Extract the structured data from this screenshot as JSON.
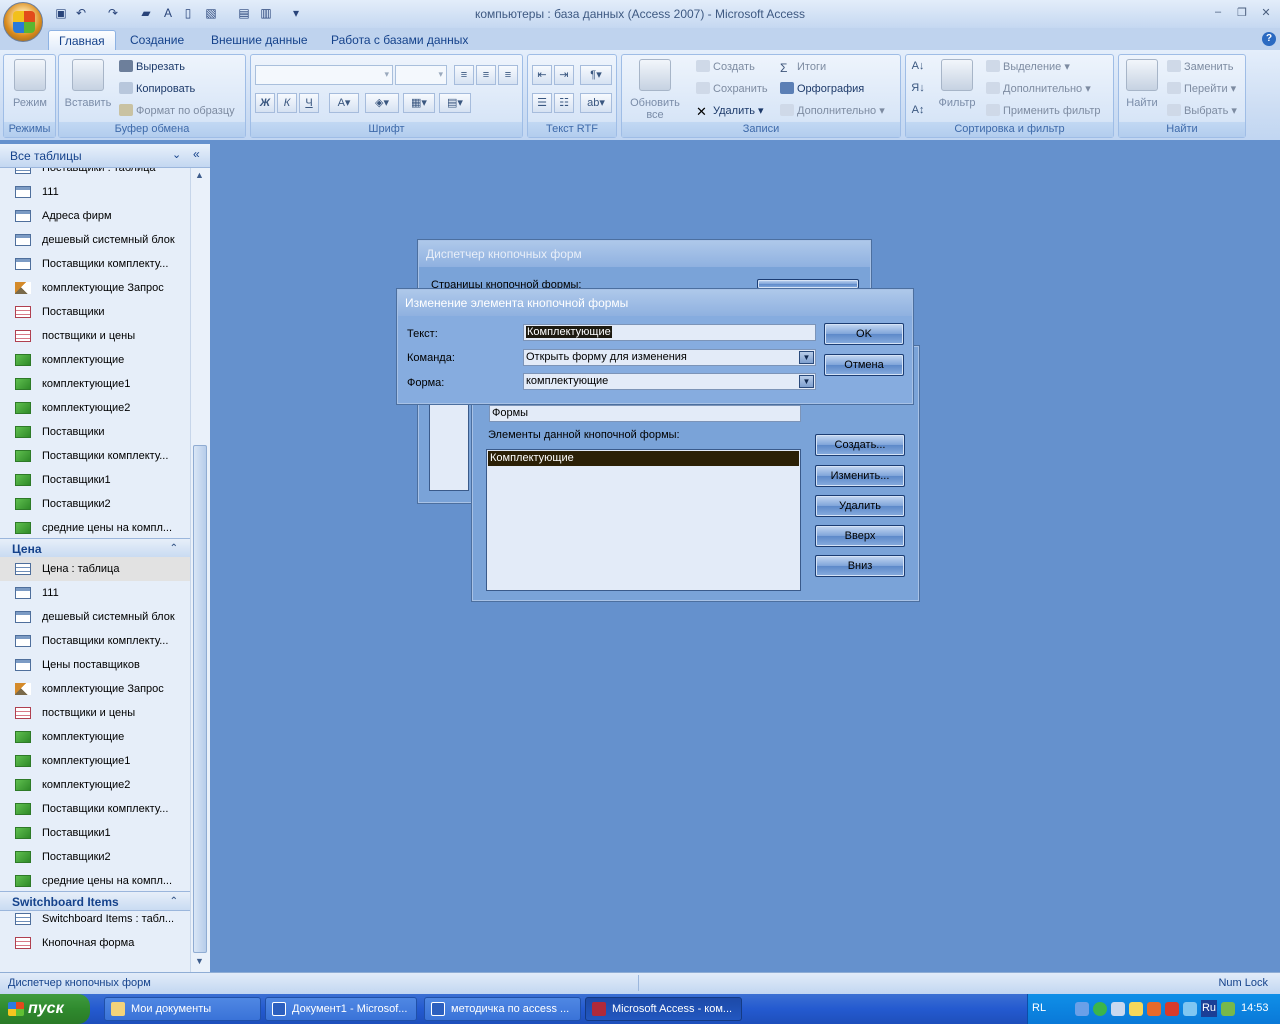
{
  "window": {
    "title": "компьютеры : база данных (Access 2007) - Microsoft Access",
    "controls": [
      "minimize",
      "restore",
      "close"
    ]
  },
  "ribbon": {
    "tabs": [
      "Главная",
      "Создание",
      "Внешние данные",
      "Работа с базами данных"
    ],
    "active_tab": "Главная",
    "groups": {
      "views": {
        "label": "Режимы",
        "mode": "Режим"
      },
      "clipboard": {
        "label": "Буфер обмена",
        "paste": "Вставить",
        "cut": "Вырезать",
        "copy": "Копировать",
        "format_painter": "Формат по образцу"
      },
      "font": {
        "label": "Шрифт",
        "bold": "Ж",
        "italic": "К",
        "underline": "Ч"
      },
      "rtf": {
        "label": "Текст RTF"
      },
      "records": {
        "label": "Записи",
        "refresh": "Обновить все",
        "new": "Создать",
        "save": "Сохранить",
        "delete": "Удалить",
        "totals": "Итоги",
        "spelling": "Орфография",
        "more": "Дополнительно"
      },
      "sort_filter": {
        "label": "Сортировка и фильтр",
        "filter": "Фильтр",
        "selection": "Выделение",
        "advanced": "Дополнительно",
        "apply_filter": "Применить фильтр"
      },
      "find": {
        "label": "Найти",
        "find": "Найти",
        "replace": "Заменить",
        "goto": "Перейти",
        "select": "Выбрать"
      }
    }
  },
  "nav": {
    "header": "Все таблицы",
    "group1_items": [
      {
        "label": "Поставщики : таблица",
        "icon": "table"
      },
      {
        "label": "111",
        "icon": "query"
      },
      {
        "label": "Адреса фирм",
        "icon": "query"
      },
      {
        "label": "дешевый системный блок",
        "icon": "query"
      },
      {
        "label": "Поставщики комплекту...",
        "icon": "query"
      },
      {
        "label": "комплектующие Запрос",
        "icon": "action"
      },
      {
        "label": "Поставщики",
        "icon": "report"
      },
      {
        "label": "поствщики и цены",
        "icon": "report"
      },
      {
        "label": "комплектующие",
        "icon": "form"
      },
      {
        "label": "комплектующие1",
        "icon": "form"
      },
      {
        "label": "комплектующие2",
        "icon": "form"
      },
      {
        "label": "Поставщики",
        "icon": "form"
      },
      {
        "label": "Поставщики комплекту...",
        "icon": "form"
      },
      {
        "label": "Поставщики1",
        "icon": "form"
      },
      {
        "label": "Поставщики2",
        "icon": "form"
      },
      {
        "label": "средние цены на компл...",
        "icon": "form"
      }
    ],
    "group2_title": "Цена",
    "group2_items": [
      {
        "label": "Цена : таблица",
        "icon": "table"
      },
      {
        "label": "111",
        "icon": "query"
      },
      {
        "label": "дешевый системный блок",
        "icon": "query"
      },
      {
        "label": "Поставщики комплекту...",
        "icon": "query"
      },
      {
        "label": "Цены поставщиков",
        "icon": "query"
      },
      {
        "label": "комплектующие Запрос",
        "icon": "action"
      },
      {
        "label": "поствщики и цены",
        "icon": "report"
      },
      {
        "label": "комплектующие",
        "icon": "form"
      },
      {
        "label": "комплектующие1",
        "icon": "form"
      },
      {
        "label": "комплектующие2",
        "icon": "form"
      },
      {
        "label": "Поставщики комплекту...",
        "icon": "form"
      },
      {
        "label": "Поставщики1",
        "icon": "form"
      },
      {
        "label": "Поставщики2",
        "icon": "form"
      },
      {
        "label": "средние цены на компл...",
        "icon": "form"
      }
    ],
    "group3_title": "Switchboard Items",
    "group3_items": [
      {
        "label": "Switchboard Items : табл...",
        "icon": "table"
      },
      {
        "label": "Кнопочная форма",
        "icon": "report"
      }
    ]
  },
  "dialog_back": {
    "title": "Диспетчер кнопочных форм",
    "pages_label": "Страницы кнопочной формы:"
  },
  "dialog_mid": {
    "name_value": "Формы",
    "items_label": "Элементы данной кнопочной формы:",
    "items": [
      "Комплектующие"
    ],
    "buttons": {
      "create": "Создать...",
      "edit": "Изменить...",
      "delete": "Удалить",
      "up": "Вверх",
      "down": "Вниз"
    }
  },
  "dialog_front": {
    "title": "Изменение элемента кнопочной формы",
    "text_label": "Текст:",
    "text_value": "Комплектующие",
    "command_label": "Команда:",
    "command_value": "Открыть форму для изменения",
    "form_label": "Форма:",
    "form_value": "комплектующие",
    "ok": "OK",
    "cancel": "Отмена"
  },
  "status": {
    "left": "Диспетчер кнопочных форм",
    "right": "Num Lock"
  },
  "taskbar": {
    "start": "пуск",
    "tasks": [
      {
        "label": "Мои документы",
        "active": false
      },
      {
        "label": "Документ1 - Microsof...",
        "active": false
      },
      {
        "label": "методичка по access ...",
        "active": false
      },
      {
        "label": "Microsoft Access - ком...",
        "active": true
      }
    ],
    "lang_left": "RL",
    "lang": "Ru",
    "clock": "14:53"
  },
  "colors": {
    "workspace": "#6591cd",
    "dialog_body": "#7aa3d8",
    "taskbar": "#245ad0",
    "start_button": "#2f8a2e"
  }
}
